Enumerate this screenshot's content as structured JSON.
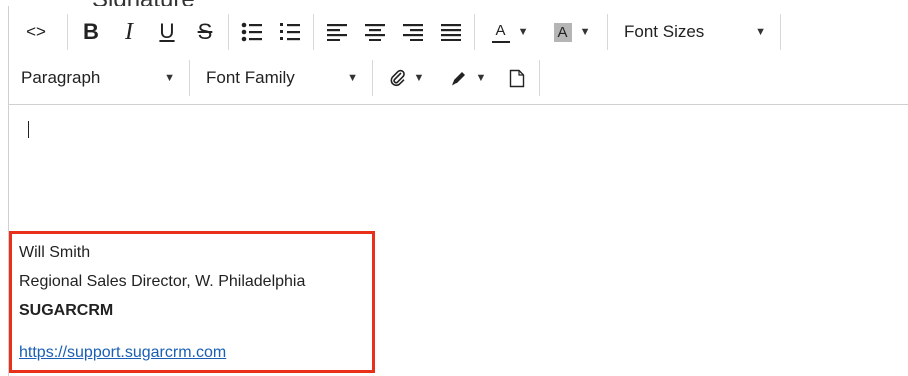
{
  "page": {
    "partial_heading": "Signature"
  },
  "toolbar": {
    "row1": {
      "code_label": "<>",
      "bold_label": "B",
      "italic_label": "I",
      "underline_label": "U",
      "strike_label": "S",
      "text_color_label": "A",
      "bg_color_label": "A",
      "font_sizes_label": "Font Sizes"
    },
    "row2": {
      "paragraph_label": "Paragraph",
      "font_family_label": "Font Family"
    },
    "icons": [
      "code-icon",
      "bold-icon",
      "italic-icon",
      "underline-icon",
      "strikethrough-icon",
      "bullet-list-icon",
      "numbered-list-icon",
      "align-left-icon",
      "align-center-icon",
      "align-right-icon",
      "align-justify-icon",
      "text-color-icon",
      "background-color-icon",
      "chevron-down-icon",
      "paperclip-icon",
      "pencil-icon",
      "document-icon"
    ],
    "colors": {
      "text_color_bar": "#222222",
      "bg_color_swatch": "#b5b5b5"
    }
  },
  "signature": {
    "name": "Will Smith",
    "title": "Regional Sales Director, W. Philadelphia",
    "company": "SUGARCRM",
    "link": "https://support.sugarcrm.com",
    "highlight_color": "#e8311a"
  }
}
